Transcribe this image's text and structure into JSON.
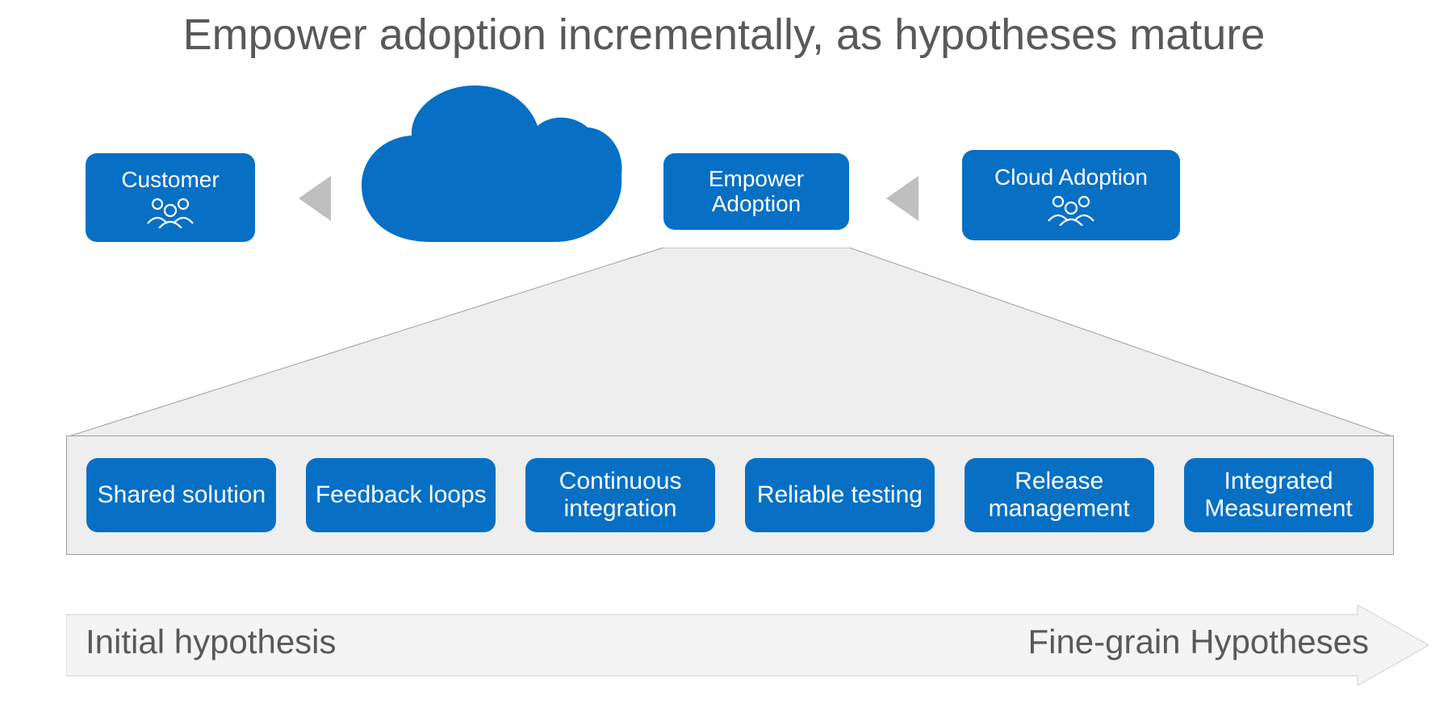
{
  "title": "Empower adoption incrementally, as hypotheses mature",
  "flow": {
    "customer": "Customer",
    "empower": "Empower Adoption",
    "cloud_adoption": "Cloud Adoption"
  },
  "details": [
    "Shared solution",
    "Feedback loops",
    "Continuous integration",
    "Reliable testing",
    "Release management",
    "Integrated Measurement"
  ],
  "hypothesis": {
    "left": "Initial hypothesis",
    "right": "Fine-grain Hypotheses"
  },
  "colors": {
    "accent": "#0770c5",
    "muted_text": "#595959",
    "arrow_gray": "#bfbfbf",
    "panel_bg": "#eeeeee",
    "panel_border": "#9e9e9e"
  }
}
